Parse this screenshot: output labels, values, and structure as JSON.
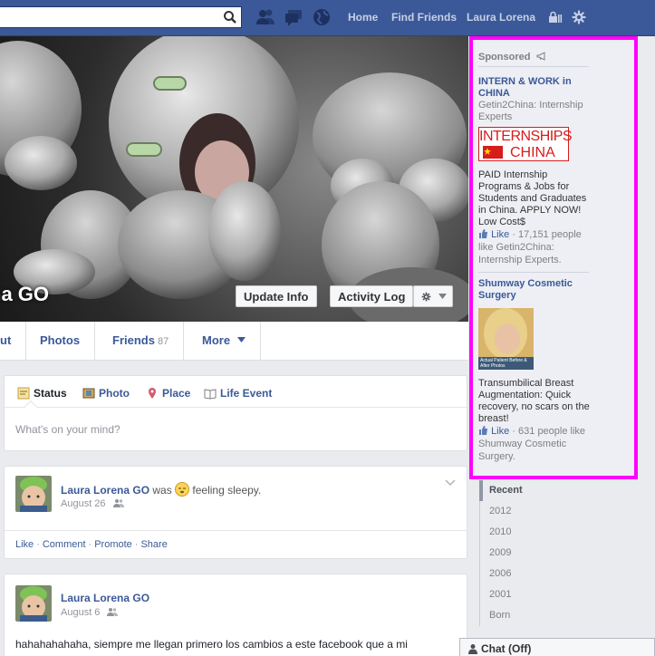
{
  "topbar": {
    "search": {
      "value": "",
      "placeholder": ""
    },
    "nav": {
      "home": "Home",
      "find_friends": "Find Friends",
      "user": "Laura Lorena"
    }
  },
  "profile": {
    "name": "na GO",
    "buttons": {
      "update_info": "Update Info",
      "activity_log": "Activity Log"
    },
    "tabs": [
      {
        "label": "ut"
      },
      {
        "label": "Photos"
      },
      {
        "label": "Friends",
        "count": "87"
      },
      {
        "label": "More"
      }
    ]
  },
  "composer": {
    "tabs": [
      "Status",
      "Photo",
      "Place",
      "Life Event"
    ],
    "placeholder": "What's on your mind?"
  },
  "posts": [
    {
      "author": "Laura Lorena GO",
      "status": "was",
      "feeling": "feeling sleepy.",
      "date": "August 26",
      "actions": [
        "Like",
        "Comment",
        "Promote",
        "Share"
      ]
    },
    {
      "author": "Laura Lorena GO",
      "date": "August 6",
      "text": "hahahahahaha, siempre me llegan primero los cambios a este facebook que a mi"
    }
  ],
  "sponsored": {
    "header": "Sponsored",
    "ads": [
      {
        "title": "INTERN & WORK in CHINA",
        "source": "Getin2China: Internship Experts",
        "image_text": [
          "INTERNSHIPS",
          "CHINA"
        ],
        "body": "PAID Internship Programs & Jobs for Students and Graduates in China. APPLY NOW! Low Cost$",
        "like_label": "Like",
        "like_text": "· 17,151 people like Getin2China: Internship Experts."
      },
      {
        "title": "Shumway Cosmetic Surgery",
        "image_caption": "Actual Patient Before & After Photos",
        "body": "Transumbilical Breast Augmentation: Quick recovery, no scars on the breast!",
        "like_label": "Like",
        "like_text": "· 631 people like Shumway Cosmetic Surgery."
      }
    ]
  },
  "timeline_nav": [
    "Recent",
    "2012",
    "2010",
    "2009",
    "2006",
    "2001",
    "Born"
  ],
  "chat": {
    "label": "Chat (Off)"
  },
  "colors": {
    "brand": "#3b5998",
    "highlight": "#ff00ff",
    "link": "#3b5998",
    "china_red": "#d71c1c"
  }
}
